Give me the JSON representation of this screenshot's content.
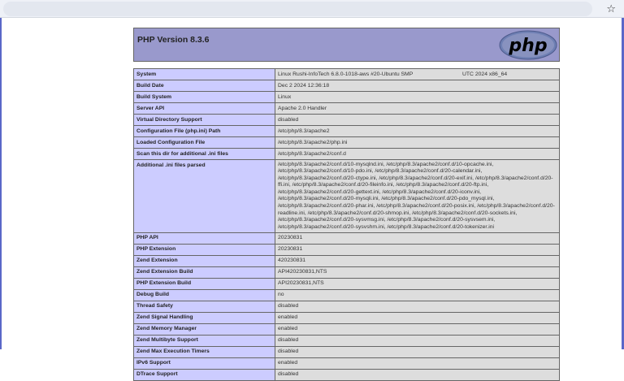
{
  "browser": {
    "bookmark_icon": "star-icon"
  },
  "header": {
    "title": "PHP Version 8.3.6",
    "logo_text": "php"
  },
  "rows": [
    {
      "label": "System",
      "value": "Linux Rushi-InfoTech 6.8.0-1018-aws #20-Ubuntu SMP",
      "value_extra": "UTC 2024 x86_64"
    },
    {
      "label": "Build Date",
      "value": "Dec 2 2024 12:36:18"
    },
    {
      "label": "Build System",
      "value": "Linux"
    },
    {
      "label": "Server API",
      "value": "Apache 2.0 Handler"
    },
    {
      "label": "Virtual Directory Support",
      "value": "disabled"
    },
    {
      "label": "Configuration File (php.ini) Path",
      "value": "/etc/php/8.3/apache2"
    },
    {
      "label": "Loaded Configuration File",
      "value": "/etc/php/8.3/apache2/php.ini"
    },
    {
      "label": "Scan this dir for additional .ini files",
      "value": "/etc/php/8.3/apache2/conf.d"
    },
    {
      "label": "Additional .ini files parsed",
      "lines": [
        "/etc/php/8.3/apache2/conf.d/10-mysqlnd.ini, /etc/php/8.3/apache2/conf.d/10-opcache.ini,",
        "/etc/php/8.3/apache2/conf.d/10-pdo.ini, /etc/php/8.3/apache2/conf.d/20-calendar.ini,",
        "/etc/php/8.3/apache2/conf.d/20-ctype.ini, /etc/php/8.3/apache2/conf.d/20-exif.ini, /etc/php/8.3/apache2/conf.d/20-",
        "ffi.ini, /etc/php/8.3/apache2/conf.d/20-fileinfo.ini, /etc/php/8.3/apache2/conf.d/20-ftp.ini,",
        "/etc/php/8.3/apache2/conf.d/20-gettext.ini, /etc/php/8.3/apache2/conf.d/20-iconv.ini,",
        "/etc/php/8.3/apache2/conf.d/20-mysqli.ini, /etc/php/8.3/apache2/conf.d/20-pdo_mysql.ini,",
        "/etc/php/8.3/apache2/conf.d/20-phar.ini, /etc/php/8.3/apache2/conf.d/20-posix.ini, /etc/php/8.3/apache2/conf.d/20-",
        "readline.ini, /etc/php/8.3/apache2/conf.d/20-shmop.ini, /etc/php/8.3/apache2/conf.d/20-sockets.ini,",
        "/etc/php/8.3/apache2/conf.d/20-sysvmsg.ini, /etc/php/8.3/apache2/conf.d/20-sysvsem.ini,",
        "/etc/php/8.3/apache2/conf.d/20-sysvshm.ini, /etc/php/8.3/apache2/conf.d/20-tokenizer.ini"
      ]
    },
    {
      "label": "PHP API",
      "value": "20230831"
    },
    {
      "label": "PHP Extension",
      "value": "20230831"
    },
    {
      "label": "Zend Extension",
      "value": "420230831"
    },
    {
      "label": "Zend Extension Build",
      "value": "API420230831,NTS"
    },
    {
      "label": "PHP Extension Build",
      "value": "API20230831,NTS"
    },
    {
      "label": "Debug Build",
      "value": "no"
    },
    {
      "label": "Thread Safety",
      "value": "disabled"
    },
    {
      "label": "Zend Signal Handling",
      "value": "enabled"
    },
    {
      "label": "Zend Memory Manager",
      "value": "enabled"
    },
    {
      "label": "Zend Multibyte Support",
      "value": "disabled"
    },
    {
      "label": "Zend Max Execution Timers",
      "value": "disabled"
    },
    {
      "label": "IPv6 Support",
      "value": "enabled"
    },
    {
      "label": "DTrace Support",
      "value": "disabled"
    }
  ]
}
